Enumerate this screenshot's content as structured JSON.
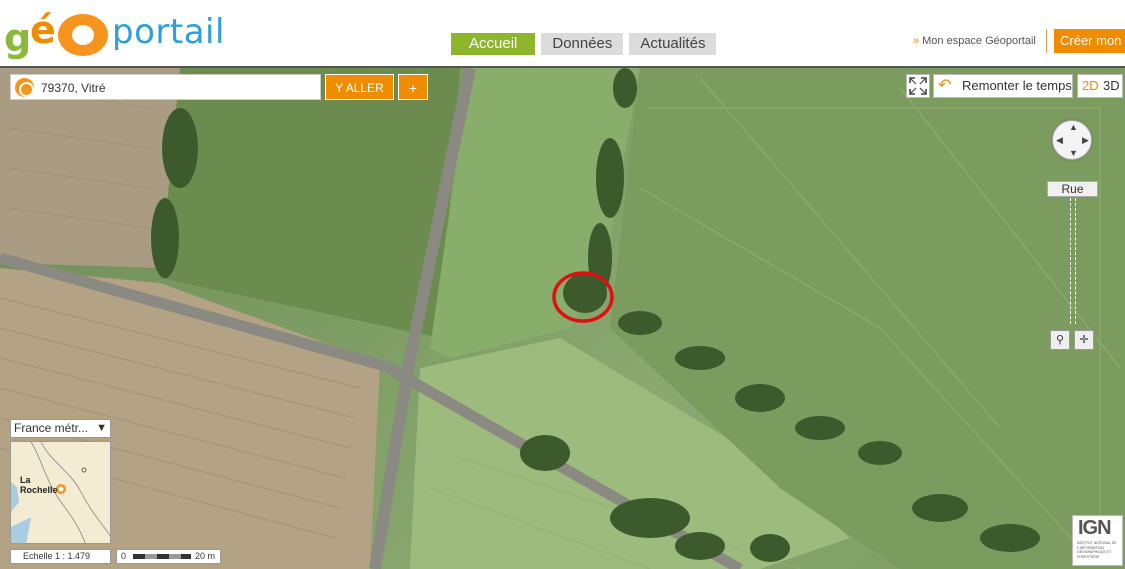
{
  "header": {
    "logo_text": "géoportail",
    "nav_tabs": [
      {
        "label": "Accueil",
        "active": true
      },
      {
        "label": "Données",
        "active": false
      },
      {
        "label": "Actualités",
        "active": false
      }
    ],
    "espace_link": "Mon espace Géoportail",
    "creer_button": "Créer mon e"
  },
  "search": {
    "value": "79370, Vitré",
    "go_button": "Y ALLER",
    "plus_button": "+"
  },
  "tools": {
    "remonter_label": "Remonter le temps",
    "view_2d": "2D",
    "view_3d": "3D",
    "rue_label": "Rue"
  },
  "overview": {
    "territory": "France métr...",
    "minimap_city": "La Rochelle",
    "scale_label": "Echelle 1 :  1.479",
    "scalebar_zero": "0",
    "scalebar_distance": "20 m"
  },
  "ign": {
    "logo": "IGN",
    "subtitle": "INSTITUT NATIONAL DE L'INFORMATION GÉOGRAPHIQUE ET FORESTIÈRE"
  },
  "colors": {
    "brand_green": "#8db62c",
    "brand_orange": "#f08c00",
    "brand_blue": "#2f9fd8",
    "annotation_red": "#e01010"
  },
  "icons": [
    "locate-icon",
    "fullscreen-icon",
    "undo-arrow-icon",
    "nav-pad-icon",
    "zoom-magnifier-icon",
    "crosshair-icon",
    "dropdown-arrow-icon"
  ]
}
